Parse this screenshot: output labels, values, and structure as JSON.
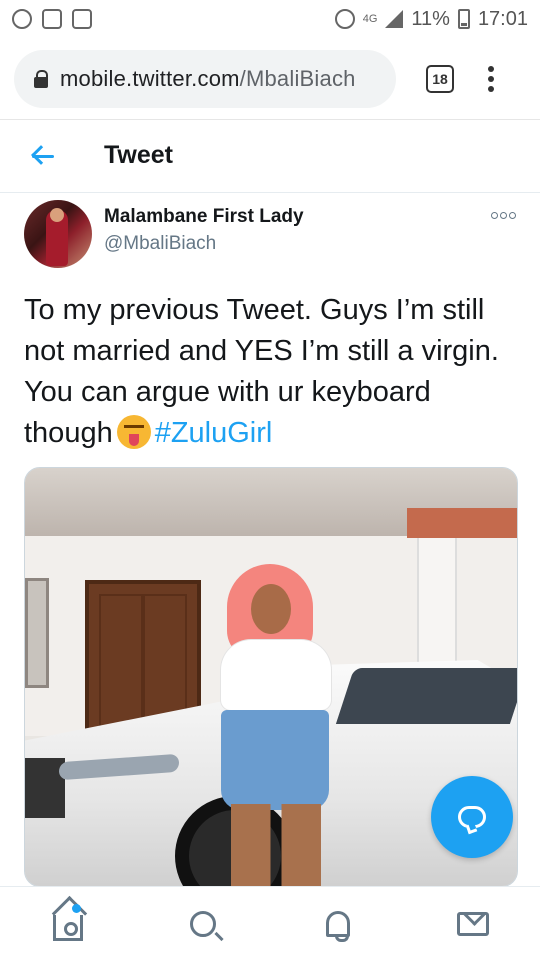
{
  "status_bar": {
    "network": "4G",
    "battery": "11%",
    "time": "17:01",
    "icons": [
      "whatsapp-icon",
      "notification-icon",
      "gallery-icon",
      "alarm-icon",
      "signal-icon",
      "battery-icon"
    ]
  },
  "browser": {
    "url_host": "mobile.twitter.com",
    "url_path": "/MbaliBiach",
    "tab_count": "18"
  },
  "header": {
    "title": "Tweet"
  },
  "tweet": {
    "author_name": "Malambane First Lady",
    "author_handle": "@MbaliBiach",
    "text": "To my previous Tweet. Guys I’m still not married and YES I’m still a virgin. You can argue with ur keyboard though",
    "emoji": "squinting-face-with-tongue",
    "hashtag": "#ZuluGirl"
  },
  "nav": {
    "items": [
      "home",
      "search",
      "notifications",
      "messages"
    ]
  },
  "colors": {
    "accent": "#1da1f2",
    "text": "#14171a",
    "secondary_text": "#657786"
  }
}
